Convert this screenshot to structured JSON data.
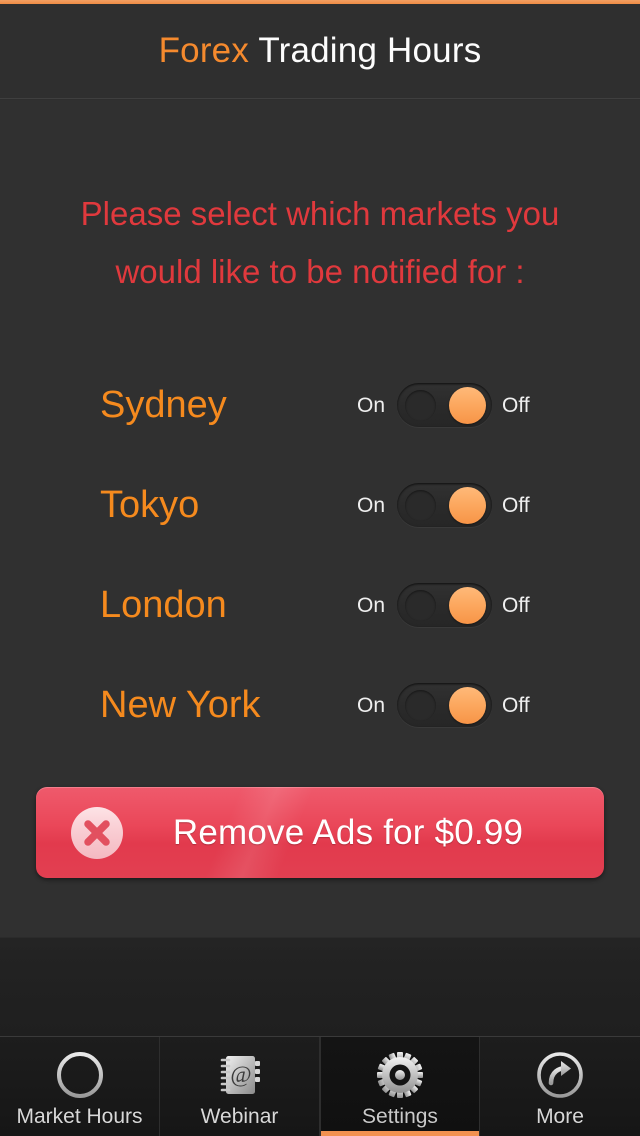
{
  "app": {
    "accent_color": "#f2a063",
    "background_color": "#303030"
  },
  "header": {
    "brand": "Forex",
    "title_rest": " Trading Hours",
    "brand_color": "#f58a2e",
    "title_color": "#fdfdfd"
  },
  "instructions": {
    "line1": "Please select which markets you",
    "line2": "would like to be notified for :",
    "color": "#e0393d"
  },
  "markets": [
    {
      "name": "Sydney",
      "toggle_on_label": "On",
      "toggle_off_label": "Off",
      "state": "off"
    },
    {
      "name": "Tokyo",
      "toggle_on_label": "On",
      "toggle_off_label": "Off",
      "state": "off"
    },
    {
      "name": "London",
      "toggle_on_label": "On",
      "toggle_off_label": "Off",
      "state": "off"
    },
    {
      "name": "New York",
      "toggle_on_label": "On",
      "toggle_off_label": "Off",
      "state": "off"
    }
  ],
  "market_name_color": "#f58a1e",
  "remove_ads": {
    "label": "Remove Ads for $0.99",
    "icon": "close-circle-icon",
    "button_color": "#e7495b"
  },
  "ad_banner": {
    "content": ""
  },
  "tabs": [
    {
      "label": "Market Hours",
      "icon": "clock-icon",
      "active": false
    },
    {
      "label": "Webinar",
      "icon": "notebook-at-icon",
      "active": false
    },
    {
      "label": "Settings",
      "icon": "gear-icon",
      "active": true
    },
    {
      "label": "More",
      "icon": "share-arrow-circle-icon",
      "active": false
    }
  ],
  "tab_active_indicator_color": "#f29150"
}
